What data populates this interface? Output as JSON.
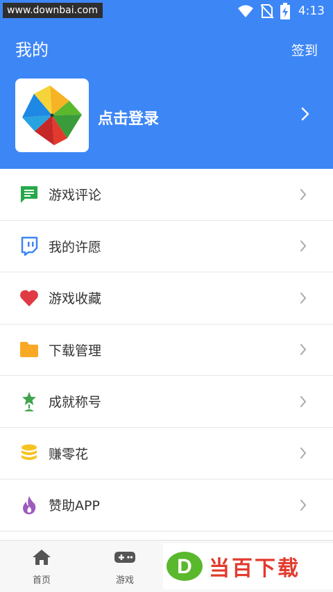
{
  "status_bar": {
    "watermark": "www.downbai.com",
    "time": "4:13"
  },
  "header": {
    "title": "我的",
    "checkin_label": "签到",
    "login_label": "点击登录"
  },
  "menu": {
    "items": [
      {
        "label": "游戏评论",
        "icon": "comment-icon"
      },
      {
        "label": "我的许愿",
        "icon": "wish-icon"
      },
      {
        "label": "游戏收藏",
        "icon": "heart-icon"
      },
      {
        "label": "下载管理",
        "icon": "folder-icon"
      },
      {
        "label": "成就称号",
        "icon": "trophy-icon"
      },
      {
        "label": "赚零花",
        "icon": "coins-icon"
      },
      {
        "label": "赞助APP",
        "icon": "flame-icon"
      }
    ]
  },
  "tabbar": {
    "tabs": [
      {
        "label": "首页",
        "icon": "home-icon"
      },
      {
        "label": "游戏",
        "icon": "gamepad-icon"
      }
    ],
    "brand_text": "当百下载",
    "brand_letter": "D"
  },
  "colors": {
    "header_bg": "#3d86f6",
    "comment": "#27a84a",
    "wish": "#3d86f6",
    "heart": "#e03a45",
    "folder": "#f9a825",
    "trophy": "#3fa34d",
    "coins": "#f6c324",
    "flame": "#9c5bbd",
    "brand_red": "#e23a2d",
    "brand_green": "#5ab82d"
  }
}
